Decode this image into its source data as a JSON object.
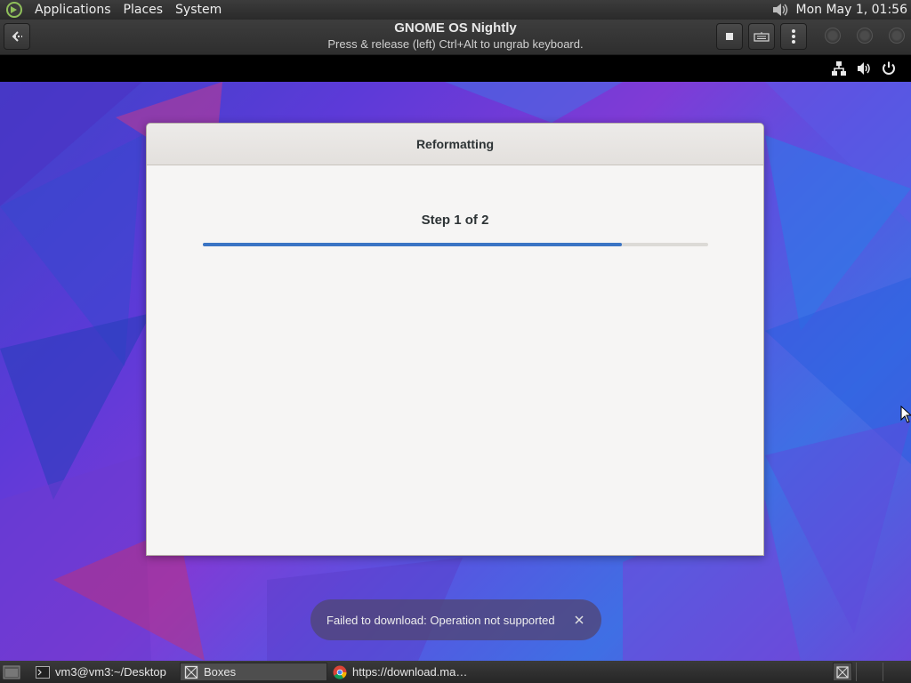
{
  "top_panel": {
    "menus": [
      {
        "label": "Applications"
      },
      {
        "label": "Places"
      },
      {
        "label": "System"
      }
    ],
    "clock": "Mon May  1, 01:56"
  },
  "header_bar": {
    "title": "GNOME OS Nightly",
    "subtitle": "Press & release (left) Ctrl+Alt to ungrab keyboard."
  },
  "dialog": {
    "title": "Reformatting",
    "step_label": "Step 1 of 2",
    "progress": 0.83
  },
  "toast": {
    "message": "Failed to download: Operation not supported"
  },
  "taskbar": {
    "tasks": [
      {
        "label": "vm3@vm3:~/Desktop"
      },
      {
        "label": "Boxes"
      },
      {
        "label": "https://download.ma…"
      }
    ]
  },
  "colors": {
    "accent": "#3a74c4",
    "panel_bg": "#2e2e2e"
  }
}
